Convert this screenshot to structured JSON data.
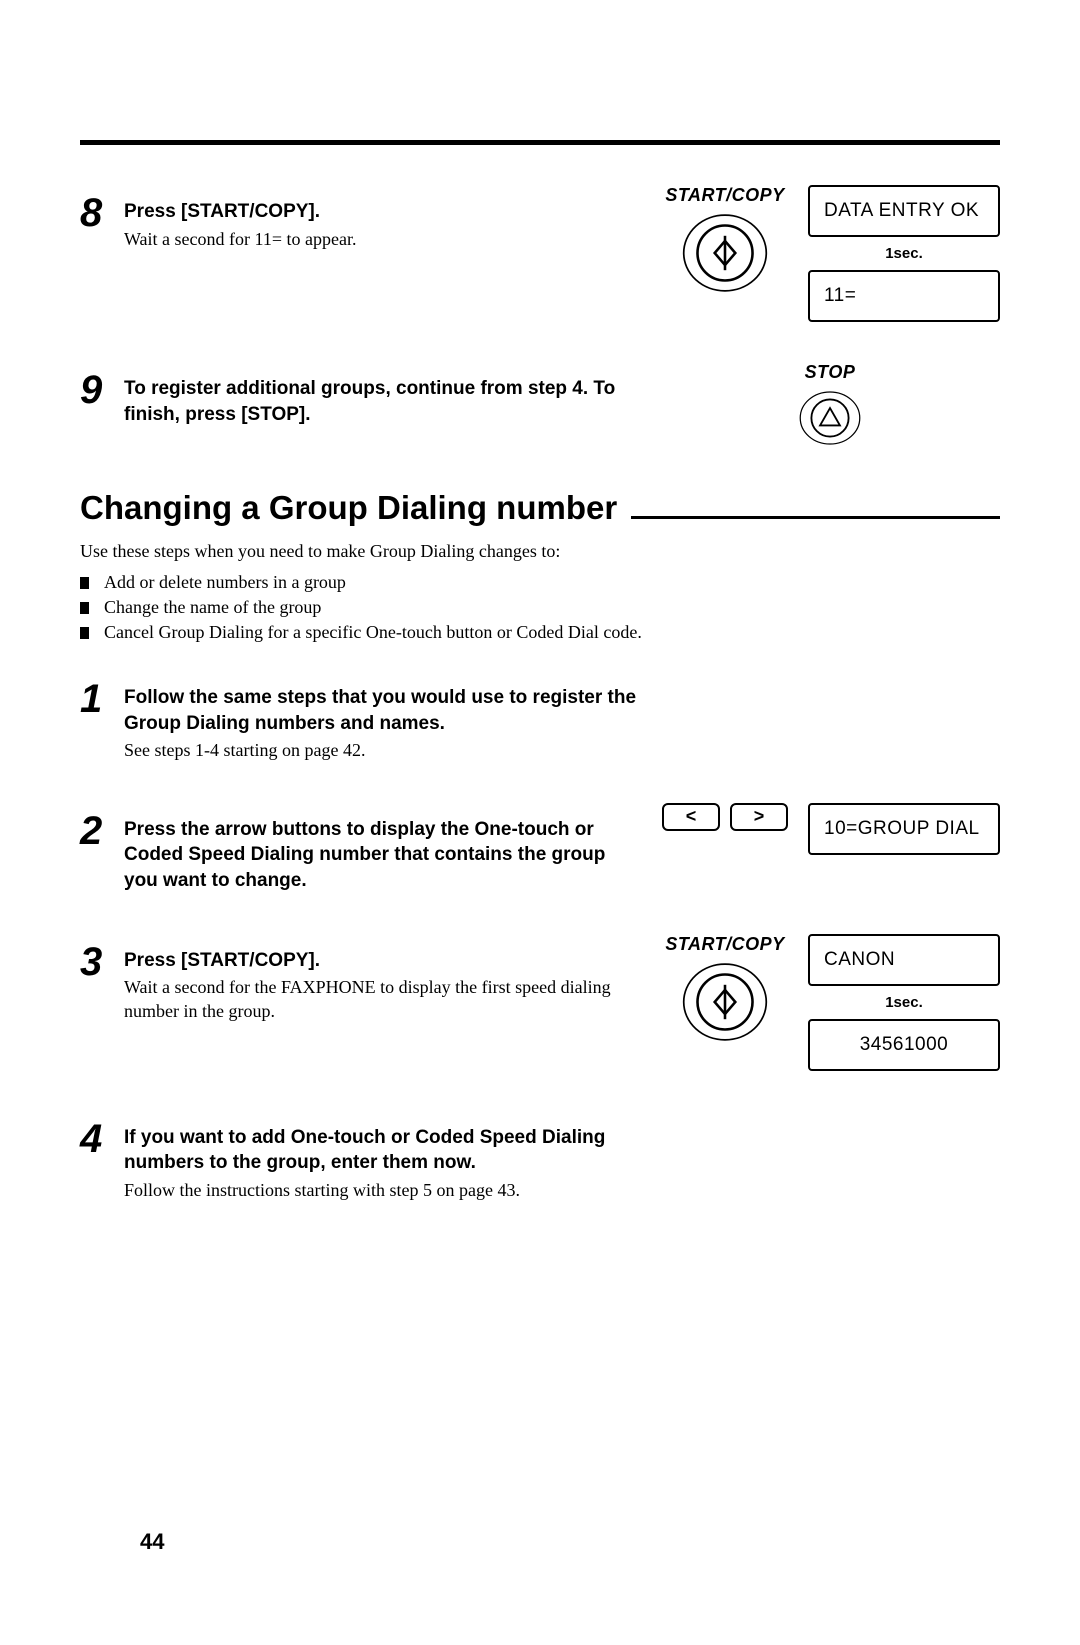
{
  "page_number": "44",
  "step8": {
    "num": "8",
    "title": "Press [START/COPY].",
    "body": "Wait a second for 11= to appear.",
    "btn_label": "START/COPY",
    "lcd1": "DATA ENTRY OK",
    "timing": "1sec.",
    "lcd2": "11="
  },
  "step9": {
    "num": "9",
    "title": "To register additional groups, continue from step 4. To finish, press [STOP].",
    "btn_label": "STOP"
  },
  "section": {
    "heading": "Changing a Group Dialing number",
    "intro": "Use these steps when you need to make Group Dialing changes to:",
    "bullets": [
      "Add or delete numbers in a group",
      "Change the name of the group",
      "Cancel Group Dialing for a specific One-touch button or Coded Dial code."
    ]
  },
  "s1": {
    "num": "1",
    "title": "Follow the same steps that you would use to register the Group Dialing numbers and names.",
    "body": "See steps 1-4 starting on page 42."
  },
  "s2": {
    "num": "2",
    "title": "Press the arrow buttons to display the One-touch or Coded Speed Dialing number that contains the group you want to change.",
    "arrow_left": "<",
    "arrow_right": ">",
    "lcd": "10=GROUP DIAL"
  },
  "s3": {
    "num": "3",
    "title": "Press [START/COPY].",
    "body": "Wait a second for the FAXPHONE to display the first speed dialing number in the group.",
    "btn_label": "START/COPY",
    "lcd1": "CANON",
    "timing": "1sec.",
    "lcd2": "34561000"
  },
  "s4": {
    "num": "4",
    "title": "If you want to add One-touch or Coded Speed Dialing numbers to the group, enter them now.",
    "body": "Follow the instructions starting with step 5 on page 43."
  }
}
